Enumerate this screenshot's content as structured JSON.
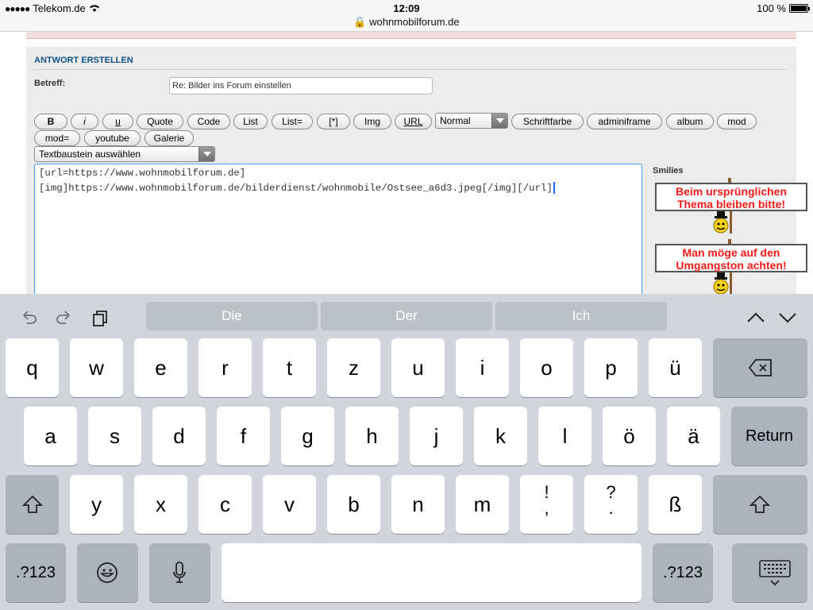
{
  "status_bar": {
    "signal": "●●●●●",
    "carrier": "Telekom.de",
    "time": "12:09",
    "url": "wohnmobilforum.de",
    "battery": "100 %"
  },
  "form": {
    "title": "ANTWORT ERSTELLEN",
    "subject_label": "Betreff:",
    "subject_value": "Re: Bilder ins Forum einstellen",
    "buttons_row1": [
      "B",
      "i",
      "u",
      "Quote",
      "Code",
      "List",
      "List=",
      "[*]",
      "Img",
      "URL"
    ],
    "size_select": "Normal",
    "buttons_row1_after": [
      "Schriftfarbe",
      "adminiframe",
      "album",
      "mod"
    ],
    "buttons_row2": [
      "mod=",
      "youtube",
      "Galerie"
    ],
    "textbaustein_select": "Textbaustein auswählen",
    "message_line1": "[url=https://www.wohnmobilforum.de]",
    "message_line2": "[img]https://www.wohnmobilforum.de/bilderdienst/wohnmobile/Ostsee_a6d3.jpeg[/img][/url]",
    "smilies_label": "Smilies",
    "smiley_sign1": "Beim ursprünglichen Thema bleiben bitte!",
    "smiley_sign2": "Man möge auf den Umgangston achten!"
  },
  "keyboard": {
    "suggestions": [
      "Die",
      "Der",
      "Ich"
    ],
    "row1": [
      "q",
      "w",
      "e",
      "r",
      "t",
      "z",
      "u",
      "i",
      "o",
      "p",
      "ü"
    ],
    "row2": [
      "a",
      "s",
      "d",
      "f",
      "g",
      "h",
      "j",
      "k",
      "l",
      "ö",
      "ä"
    ],
    "return_label": "Return",
    "row3": [
      "y",
      "x",
      "c",
      "v",
      "b",
      "n",
      "m"
    ],
    "punct1_top": "!",
    "punct1_bottom": ",",
    "punct2_top": "?",
    "punct2_bottom": ".",
    "sharp_s": "ß",
    "numbers_label": ".?123",
    "icons": [
      "undo-icon",
      "redo-icon",
      "paste-icon",
      "backspace-icon",
      "shift-icon",
      "emoji-icon",
      "microphone-icon",
      "hide-keyboard-icon",
      "chevron-up-icon",
      "chevron-down-icon"
    ]
  }
}
